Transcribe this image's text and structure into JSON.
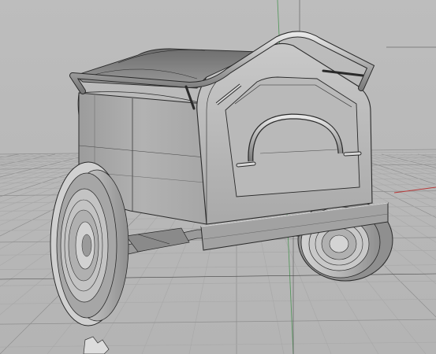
{
  "viewport": {
    "label": "",
    "display_mode": "shaded",
    "colors": {
      "background": "#b9b9b9",
      "grid_minor": "#a9a9a9",
      "grid_major": "#8e8e8e",
      "axis_x": "#b83a3a",
      "axis_y": "#2f8a3a",
      "model_fill": "#a4a4a4",
      "model_shadow": "#7e7e7e",
      "model_highlight": "#d6d6d6",
      "model_edge": "#2a2a2a"
    }
  },
  "model": {
    "name_icon": "trailer-model-icon",
    "parts": [
      "body",
      "lid",
      "handlebar",
      "tailgate",
      "tail-handle",
      "bumper",
      "left-wheel",
      "right-wheel",
      "axle"
    ]
  }
}
